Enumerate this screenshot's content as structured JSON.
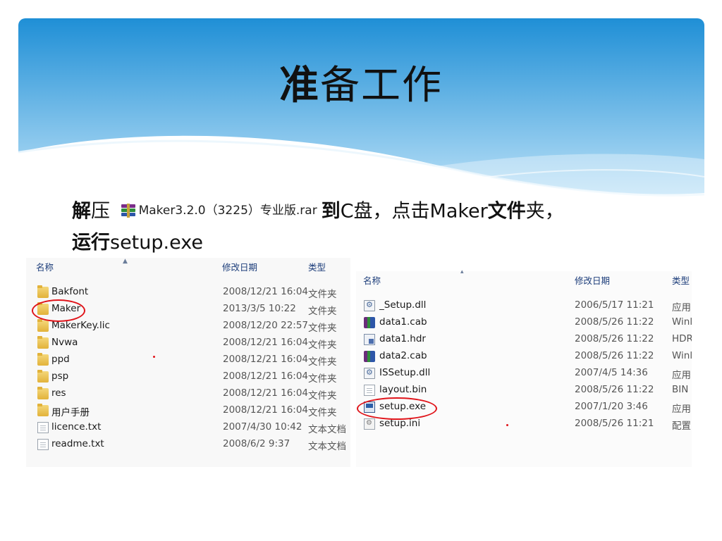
{
  "slide": {
    "title_bold": "准",
    "title_rest": "备工作",
    "instruction": {
      "p1": "解",
      "p2": "压",
      "rar_filename": "Maker3.2.0（3225）专业版.rar",
      "p3": "到",
      "p4": "C盘，点击Maker",
      "p5": "文件",
      "p6": "夹，",
      "line2_bold": "运行",
      "line2_rest": "setup.exe"
    }
  },
  "explorer_left": {
    "columns": {
      "name": "名称",
      "date": "修改日期",
      "type": "类型"
    },
    "rows": [
      {
        "icon": "folder-icon",
        "name": "Bakfont",
        "date": "2008/12/21 16:04",
        "type": "文件夹"
      },
      {
        "icon": "folder-icon",
        "name": "Maker",
        "date": "2013/3/5 10:22",
        "type": "文件夹"
      },
      {
        "icon": "folder-icon",
        "name": "MakerKey.lic",
        "date": "2008/12/20 22:57",
        "type": "文件夹"
      },
      {
        "icon": "folder-icon",
        "name": "Nvwa",
        "date": "2008/12/21 16:04",
        "type": "文件夹"
      },
      {
        "icon": "folder-icon",
        "name": "ppd",
        "date": "2008/12/21 16:04",
        "type": "文件夹"
      },
      {
        "icon": "folder-icon",
        "name": "psp",
        "date": "2008/12/21 16:04",
        "type": "文件夹"
      },
      {
        "icon": "folder-icon",
        "name": "res",
        "date": "2008/12/21 16:04",
        "type": "文件夹"
      },
      {
        "icon": "folder-icon",
        "name": "用户手册",
        "date": "2008/12/21 16:04",
        "type": "文件夹"
      },
      {
        "icon": "text-file-icon",
        "name": "licence.txt",
        "date": "2007/4/30 10:42",
        "type": "文本文档"
      },
      {
        "icon": "text-file-icon",
        "name": "readme.txt",
        "date": "2008/6/2 9:37",
        "type": "文本文档"
      }
    ]
  },
  "explorer_right": {
    "columns": {
      "name": "名称",
      "date": "修改日期",
      "type": "类型"
    },
    "rows": [
      {
        "icon": "dll-file-icon",
        "name": "_Setup.dll",
        "date": "2006/5/17 11:21",
        "type": "应用"
      },
      {
        "icon": "cab-archive-icon",
        "name": "data1.cab",
        "date": "2008/5/26 11:22",
        "type": "Winl"
      },
      {
        "icon": "hdr-file-icon",
        "name": "data1.hdr",
        "date": "2008/5/26 11:22",
        "type": "HDR"
      },
      {
        "icon": "cab-archive-icon",
        "name": "data2.cab",
        "date": "2008/5/26 11:22",
        "type": "Winl"
      },
      {
        "icon": "dll-file-icon",
        "name": "ISSetup.dll",
        "date": "2007/4/5 14:36",
        "type": "应用"
      },
      {
        "icon": "bin-file-icon",
        "name": "layout.bin",
        "date": "2008/5/26 11:22",
        "type": "BIN"
      },
      {
        "icon": "setup-exe-icon",
        "name": "setup.exe",
        "date": "2007/1/20 3:46",
        "type": "应用"
      },
      {
        "icon": "ini-file-icon",
        "name": "setup.ini",
        "date": "2008/5/26 11:21",
        "type": "配置"
      }
    ]
  },
  "colors": {
    "banner_top": "#1f8fd6",
    "banner_bottom": "#bfe3f8",
    "highlight_red": "#e0141a",
    "header_text": "#1c3d7a"
  }
}
